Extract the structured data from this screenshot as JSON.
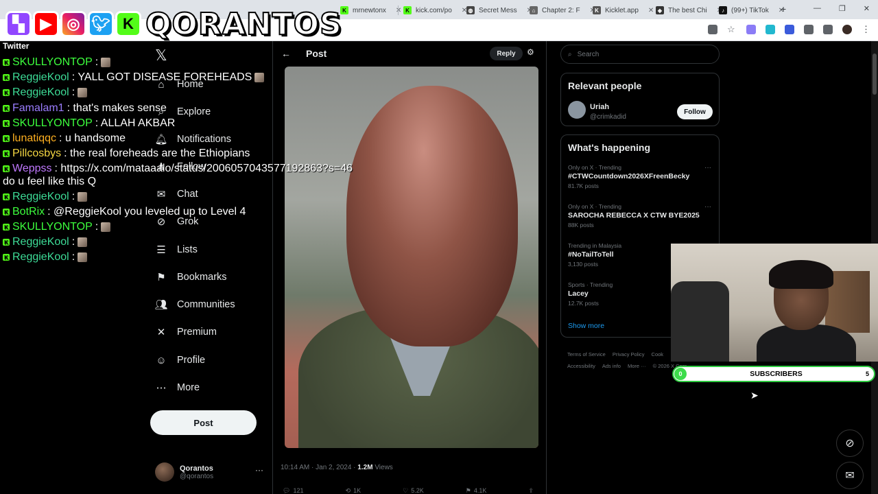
{
  "browser": {
    "tabs": [
      {
        "label": "mrnewtonx",
        "favicon": "kick",
        "color": "#53fc18"
      },
      {
        "label": "kick.com/po",
        "favicon": "kick",
        "color": "#53fc18"
      },
      {
        "label": "Secret Mess",
        "favicon": "web",
        "color": "#444"
      },
      {
        "label": "Chapter 2: F",
        "favicon": "bookmark",
        "color": "#666"
      },
      {
        "label": "Kicklet.app",
        "favicon": "kicklet",
        "color": "#555"
      },
      {
        "label": "The best Chi",
        "favicon": "shield",
        "color": "#333"
      },
      {
        "label": "(99+) TikTok",
        "favicon": "tiktok",
        "color": "#111"
      }
    ],
    "new_tab": "+",
    "window": {
      "minimize": "—",
      "restore": "❐",
      "close": "✕"
    }
  },
  "overlay": {
    "brand": "QORANTOS",
    "platforms": [
      "twitch",
      "youtube",
      "instagram",
      "twitter",
      "kick"
    ]
  },
  "chat": {
    "source": "Twitter",
    "messages": [
      {
        "user": "SKULLYONTOP",
        "color": "#3dff3d",
        "text": " :",
        "emote": true
      },
      {
        "user": "ReggieKool",
        "color": "#3ddc97",
        "text": " : YALL GOT DISEASE FOREHEADS",
        "emote": true
      },
      {
        "user": "ReggieKool",
        "color": "#3ddc97",
        "text": " :",
        "emote": true
      },
      {
        "user": "Famalam1",
        "color": "#9b7dff",
        "text": " : that's makes sense",
        "emote": false
      },
      {
        "user": "SKULLYONTOP",
        "color": "#3dff3d",
        "text": " : ALLAH AKBAR",
        "emote": false
      },
      {
        "user": "lunatiqqc",
        "color": "#ffb020",
        "text": " : u handsome",
        "emote": false
      },
      {
        "user": "Pillcosbys",
        "color": "#f5d742",
        "text": " : the real foreheads are the Ethiopians",
        "emote": false
      },
      {
        "user": "Weppss",
        "color": "#c078ff",
        "text": " : https://x.com/mataaalo/status/2006057043577192863?s=46",
        "emote": false
      },
      {
        "user": "",
        "color": "#ffffff",
        "text": "do u feel like this Q",
        "emote": false
      },
      {
        "user": "ReggieKool",
        "color": "#3ddc97",
        "text": " :",
        "emote": true
      },
      {
        "user": "BotRix",
        "color": "#3dff3d",
        "text": " : @ReggieKool you leveled up to Level 4",
        "emote": false
      },
      {
        "user": "SKULLYONTOP",
        "color": "#3dff3d",
        "text": " :",
        "emote": true
      },
      {
        "user": "ReggieKool",
        "color": "#3ddc97",
        "text": " :",
        "emote": true
      },
      {
        "user": "ReggieKool",
        "color": "#3ddc97",
        "text": " :",
        "emote": true
      }
    ]
  },
  "nav": {
    "items": [
      {
        "label": "Home",
        "icon": "home-icon",
        "glyph": "⌂"
      },
      {
        "label": "Explore",
        "icon": "search-icon",
        "glyph": "⌕"
      },
      {
        "label": "Notifications",
        "icon": "bell-icon",
        "glyph": "🔔︎"
      },
      {
        "label": "Follow",
        "icon": "follow-icon",
        "glyph": "♟"
      },
      {
        "label": "Chat",
        "icon": "chat-icon",
        "glyph": "✉"
      },
      {
        "label": "Grok",
        "icon": "grok-icon",
        "glyph": "⊘"
      },
      {
        "label": "Lists",
        "icon": "list-icon",
        "glyph": "☰"
      },
      {
        "label": "Bookmarks",
        "icon": "bookmark-icon",
        "glyph": "⚑"
      },
      {
        "label": "Communities",
        "icon": "communities-icon",
        "glyph": "👥︎"
      },
      {
        "label": "Premium",
        "icon": "x-icon",
        "glyph": "✕"
      },
      {
        "label": "Profile",
        "icon": "person-icon",
        "glyph": "☺"
      },
      {
        "label": "More",
        "icon": "more-circle-icon",
        "glyph": "⋯"
      }
    ],
    "post_label": "Post",
    "account": {
      "name": "Qorantos",
      "handle": "@qorantos",
      "dots": "···"
    }
  },
  "post": {
    "header": "Post",
    "reply_label": "Reply",
    "timestamp": "10:14 AM · Jan 2, 2024 ·",
    "views_count": "1.2M",
    "views_label": "Views",
    "actions": [
      {
        "icon": "reply-icon",
        "glyph": "💬︎",
        "count": "121"
      },
      {
        "icon": "repost-icon",
        "glyph": "⟲",
        "count": "1K"
      },
      {
        "icon": "like-icon",
        "glyph": "♡",
        "count": "5.2K"
      },
      {
        "icon": "bookmark-icon",
        "glyph": "⚑",
        "count": "4.1K"
      },
      {
        "icon": "share-icon",
        "glyph": "⇪",
        "count": ""
      }
    ]
  },
  "right": {
    "search_placeholder": "Search",
    "relevant_title": "Relevant people",
    "person": {
      "name": "Uriah",
      "handle": "@crimkadid",
      "follow": "Follow"
    },
    "happening_title": "What's happening",
    "trends": [
      {
        "context": "Only on X · Trending",
        "name": "#CTWCountdown2026XFreenBecky",
        "count": "81.7K posts"
      },
      {
        "context": "Only on X · Trending",
        "name": "SAROCHA REBECCA X CTW BYE2025",
        "count": "88K posts"
      },
      {
        "context": "Trending in Malaysia",
        "name": "#NoTailToTell",
        "count": "3,130 posts"
      },
      {
        "context": "Sports · Trending",
        "name": "Lacey",
        "count": "12.7K posts"
      }
    ],
    "show_more": "Show more",
    "footer": [
      "Terms of Service",
      "Privacy Policy",
      "Cook",
      "Accessibility",
      "Ads info",
      "More ···",
      "© 2026 X Corp."
    ]
  },
  "subscribers": {
    "label": "SUBSCRIBERS",
    "current": "0",
    "goal": "5",
    "progress": 0.0
  }
}
